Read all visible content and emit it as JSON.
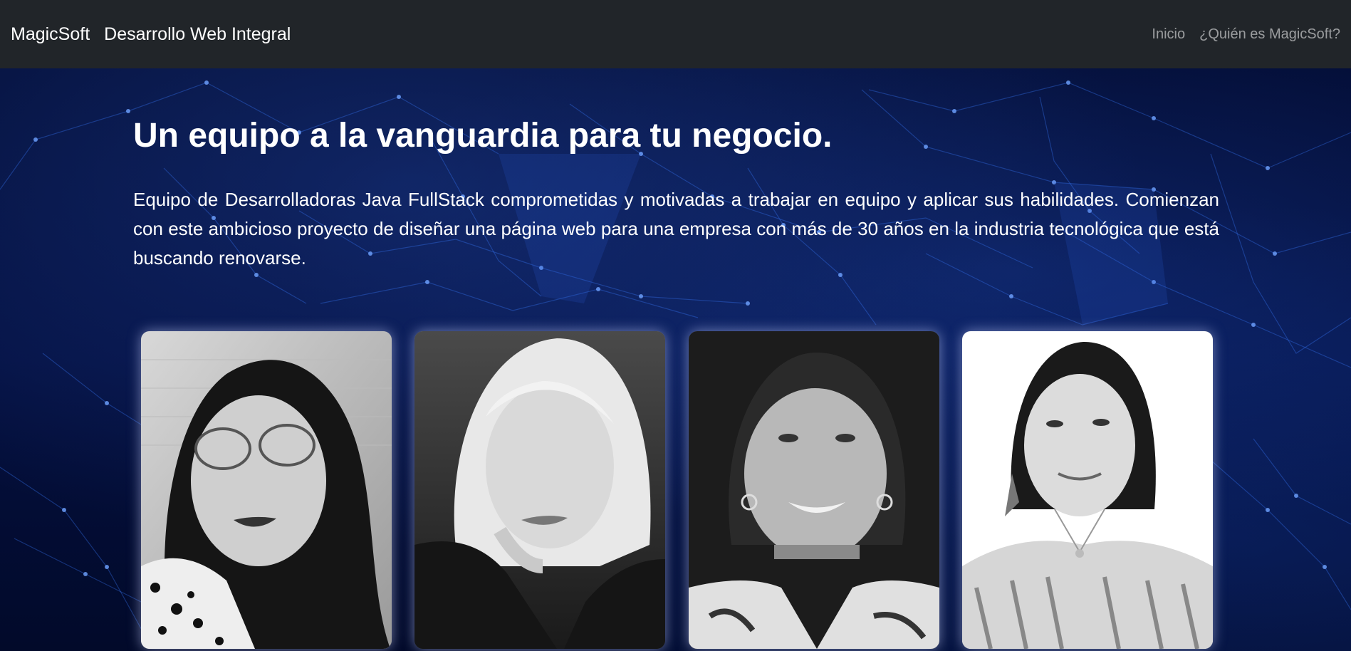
{
  "navbar": {
    "brand": "MagicSoft",
    "tagline": "Desarrollo Web Integral",
    "links": [
      "Inicio",
      "¿Quién es MagicSoft?"
    ]
  },
  "hero": {
    "title": "Un equipo a la vanguardia para tu negocio.",
    "description": "Equipo de Desarrolladoras Java FullStack comprometidas y motivadas a trabajar en equipo y aplicar sus habilidades. Comienzan con este ambicioso proyecto de diseñar una página web para una empresa con más de 30 años en la industria tecnológica que está buscando renovarse."
  },
  "team_photos": [
    "team-member-photo-1",
    "team-member-photo-2",
    "team-member-photo-3",
    "team-member-photo-4"
  ],
  "colors": {
    "navbar": "#212529",
    "background": "#020a2a",
    "network_lines": "#3a7bff"
  }
}
